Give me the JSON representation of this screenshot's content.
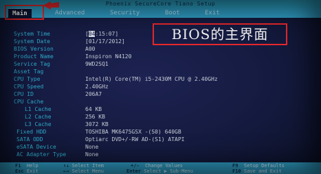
{
  "title": "Phoenix SecureCore Tiano Setup",
  "tabs": [
    {
      "label": "Main",
      "active": true
    },
    {
      "label": "Advanced"
    },
    {
      "label": "Security"
    },
    {
      "label": "Boot"
    },
    {
      "label": "Exit"
    }
  ],
  "annotation": "BIOS的主界面",
  "info": {
    "system_time": {
      "label": "System Time",
      "hour": "04",
      "rest": ":15:07]",
      "open": "["
    },
    "system_date": {
      "label": "System Date",
      "value": "[01/17/2012]"
    },
    "bios_version": {
      "label": "BIOS Version",
      "value": "A00"
    },
    "product_name": {
      "label": "Product Name",
      "value": "Inspiron N4120"
    },
    "service_tag": {
      "label": "Service Tag",
      "value": "9WD2SQ1"
    },
    "asset_tag": {
      "label": "Asset Tag",
      "value": ""
    },
    "cpu_type": {
      "label": "CPU Type",
      "value": "Intel(R) Core(TM) i5-2430M CPU @ 2.40GHz"
    },
    "cpu_speed": {
      "label": "CPU Speed",
      "value": "2.40GHz"
    },
    "cpu_id": {
      "label": "CPU ID",
      "value": "206A7"
    },
    "cpu_cache": {
      "label": "CPU Cache",
      "value": ""
    },
    "l1_cache": {
      "label": "L1 Cache",
      "value": "64 KB"
    },
    "l2_cache": {
      "label": "L2 Cache",
      "value": "256 KB"
    },
    "l3_cache": {
      "label": "L3 Cache",
      "value": "3072 KB"
    },
    "fixed_hdd": {
      "label": "Fixed HDD",
      "value": "TOSHIBA MK6475GSX   -(S0) 640GB"
    },
    "sata_odd": {
      "label": "SATA ODD",
      "value": "Optiarc DVD+/-RW AD-(S1)  ATAPI"
    },
    "esata_device": {
      "label": "eSATA Device",
      "value": "None"
    },
    "ac_adapter": {
      "label": "AC Adapter Type",
      "value": "None"
    }
  },
  "footer": {
    "f1": {
      "key": "F1",
      "desc": "Help"
    },
    "up_down": {
      "key": "↑↓",
      "desc": "Select Item"
    },
    "plus_minus": {
      "key": "+/-",
      "desc": "Change Values"
    },
    "f9": {
      "key": "F9",
      "desc": "Setup Defaults"
    },
    "esc": {
      "key": "Esc",
      "desc": "Exit"
    },
    "left_right": {
      "key": "←→",
      "desc": "Select Menu"
    },
    "enter": {
      "key": "Enter",
      "desc": "Select ▶ Sub-Menu"
    },
    "f10": {
      "key": "F10",
      "desc": "Save and Exit"
    }
  },
  "colors": {
    "bar": "#2f9dc4",
    "background": "#141a3e",
    "label": "#2fa9c9",
    "value": "#c6ccd6",
    "annotation_border": "#e8272b"
  }
}
